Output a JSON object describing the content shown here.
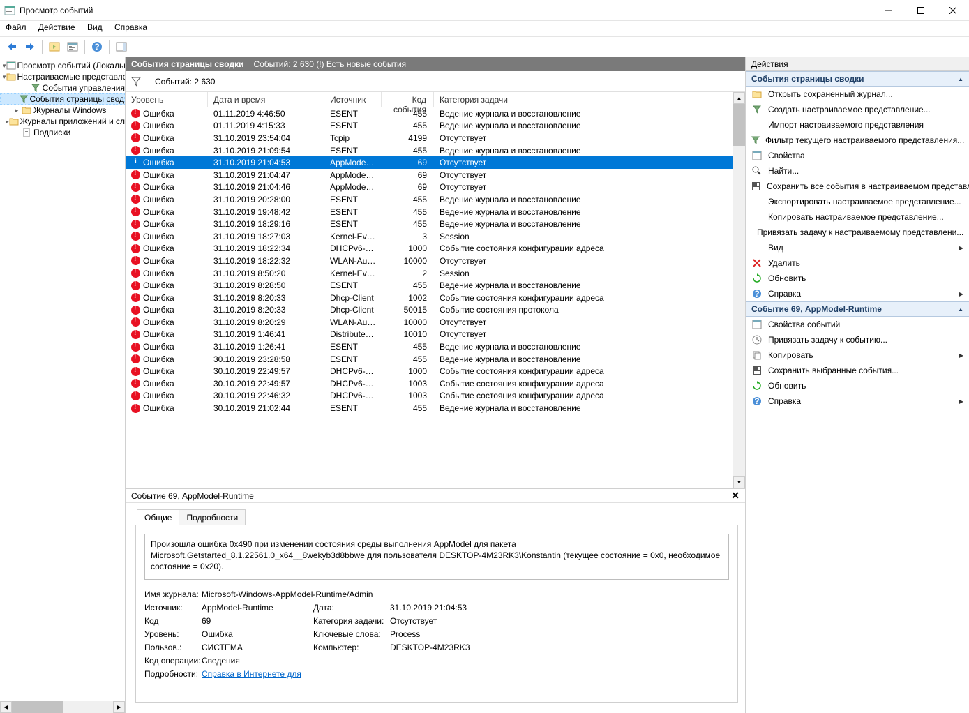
{
  "window": {
    "title": "Просмотр событий"
  },
  "menu": {
    "file": "Файл",
    "action": "Действие",
    "view": "Вид",
    "help": "Справка"
  },
  "tree": {
    "root": "Просмотр событий (Локальн",
    "custom_views": "Настраиваемые представле",
    "admin_events": "События управления",
    "summary_events": "События страницы свод",
    "windows_logs": "Журналы Windows",
    "app_service_logs": "Журналы приложений и сл",
    "subscriptions": "Подписки"
  },
  "center_header": {
    "title": "События страницы сводки",
    "count_text": "Событий: 2 630 (!) Есть новые события"
  },
  "filterbar": {
    "count": "Событий: 2 630"
  },
  "columns": {
    "level": "Уровень",
    "date": "Дата и время",
    "source": "Источник",
    "eventid": "Код события",
    "category": "Категория задачи"
  },
  "rows": [
    {
      "icon": "err",
      "level": "Ошибка",
      "date": "01.11.2019 4:46:50",
      "source": "ESENT",
      "id": "455",
      "cat": "Ведение журнала и восстановление"
    },
    {
      "icon": "err",
      "level": "Ошибка",
      "date": "01.11.2019 4:15:33",
      "source": "ESENT",
      "id": "455",
      "cat": "Ведение журнала и восстановление"
    },
    {
      "icon": "err",
      "level": "Ошибка",
      "date": "31.10.2019 23:54:04",
      "source": "Tcpip",
      "id": "4199",
      "cat": "Отсутствует"
    },
    {
      "icon": "err",
      "level": "Ошибка",
      "date": "31.10.2019 21:09:54",
      "source": "ESENT",
      "id": "455",
      "cat": "Ведение журнала и восстановление"
    },
    {
      "icon": "info",
      "level": "Ошибка",
      "date": "31.10.2019 21:04:53",
      "source": "AppModel-...",
      "id": "69",
      "cat": "Отсутствует",
      "sel": true
    },
    {
      "icon": "err",
      "level": "Ошибка",
      "date": "31.10.2019 21:04:47",
      "source": "AppModel-...",
      "id": "69",
      "cat": "Отсутствует"
    },
    {
      "icon": "err",
      "level": "Ошибка",
      "date": "31.10.2019 21:04:46",
      "source": "AppModel-...",
      "id": "69",
      "cat": "Отсутствует"
    },
    {
      "icon": "err",
      "level": "Ошибка",
      "date": "31.10.2019 20:28:00",
      "source": "ESENT",
      "id": "455",
      "cat": "Ведение журнала и восстановление"
    },
    {
      "icon": "err",
      "level": "Ошибка",
      "date": "31.10.2019 19:48:42",
      "source": "ESENT",
      "id": "455",
      "cat": "Ведение журнала и восстановление"
    },
    {
      "icon": "err",
      "level": "Ошибка",
      "date": "31.10.2019 18:29:16",
      "source": "ESENT",
      "id": "455",
      "cat": "Ведение журнала и восстановление"
    },
    {
      "icon": "err",
      "level": "Ошибка",
      "date": "31.10.2019 18:27:03",
      "source": "Kernel-Even...",
      "id": "3",
      "cat": "Session"
    },
    {
      "icon": "err",
      "level": "Ошибка",
      "date": "31.10.2019 18:22:34",
      "source": "DHCPv6-Cli...",
      "id": "1000",
      "cat": "Событие состояния конфигурации адреса"
    },
    {
      "icon": "err",
      "level": "Ошибка",
      "date": "31.10.2019 18:22:32",
      "source": "WLAN-Auto...",
      "id": "10000",
      "cat": "Отсутствует"
    },
    {
      "icon": "err",
      "level": "Ошибка",
      "date": "31.10.2019 8:50:20",
      "source": "Kernel-Even...",
      "id": "2",
      "cat": "Session"
    },
    {
      "icon": "err",
      "level": "Ошибка",
      "date": "31.10.2019 8:28:50",
      "source": "ESENT",
      "id": "455",
      "cat": "Ведение журнала и восстановление"
    },
    {
      "icon": "err",
      "level": "Ошибка",
      "date": "31.10.2019 8:20:33",
      "source": "Dhcp-Client",
      "id": "1002",
      "cat": "Событие состояния конфигурации адреса"
    },
    {
      "icon": "err",
      "level": "Ошибка",
      "date": "31.10.2019 8:20:33",
      "source": "Dhcp-Client",
      "id": "50015",
      "cat": "Событие состояния протокола"
    },
    {
      "icon": "err",
      "level": "Ошибка",
      "date": "31.10.2019 8:20:29",
      "source": "WLAN-Auto...",
      "id": "10000",
      "cat": "Отсутствует"
    },
    {
      "icon": "err",
      "level": "Ошибка",
      "date": "31.10.2019 1:46:41",
      "source": "Distributed...",
      "id": "10010",
      "cat": "Отсутствует"
    },
    {
      "icon": "err",
      "level": "Ошибка",
      "date": "31.10.2019 1:26:41",
      "source": "ESENT",
      "id": "455",
      "cat": "Ведение журнала и восстановление"
    },
    {
      "icon": "err",
      "level": "Ошибка",
      "date": "30.10.2019 23:28:58",
      "source": "ESENT",
      "id": "455",
      "cat": "Ведение журнала и восстановление"
    },
    {
      "icon": "err",
      "level": "Ошибка",
      "date": "30.10.2019 22:49:57",
      "source": "DHCPv6-Cli...",
      "id": "1000",
      "cat": "Событие состояния конфигурации адреса"
    },
    {
      "icon": "err",
      "level": "Ошибка",
      "date": "30.10.2019 22:49:57",
      "source": "DHCPv6-Cli...",
      "id": "1003",
      "cat": "Событие состояния конфигурации адреса"
    },
    {
      "icon": "err",
      "level": "Ошибка",
      "date": "30.10.2019 22:46:32",
      "source": "DHCPv6-Cli...",
      "id": "1003",
      "cat": "Событие состояния конфигурации адреса"
    },
    {
      "icon": "err",
      "level": "Ошибка",
      "date": "30.10.2019 21:02:44",
      "source": "ESENT",
      "id": "455",
      "cat": "Ведение журнала и восстановление"
    }
  ],
  "detail": {
    "header": "Событие 69, AppModel-Runtime",
    "tab_general": "Общие",
    "tab_details": "Подробности",
    "description": "Произошла ошибка 0x490 при изменении состояния среды выполнения AppModel для пакета Microsoft.Getstarted_8.1.22561.0_x64__8wekyb3d8bbwe для пользователя DESKTOP-4M23RK3\\Konstantin (текущее состояние = 0x0, необходимое состояние = 0x20).",
    "props": {
      "log_name_label": "Имя журнала:",
      "log_name": "Microsoft-Windows-AppModel-Runtime/Admin",
      "source_label": "Источник:",
      "source": "AppModel-Runtime",
      "date_label": "Дата:",
      "date": "31.10.2019 21:04:53",
      "code_label": "Код",
      "code": "69",
      "category_label": "Категория задачи:",
      "category": "Отсутствует",
      "level_label": "Уровень:",
      "level": "Ошибка",
      "keywords_label": "Ключевые слова:",
      "keywords": "Process",
      "user_label": "Пользов.:",
      "user": "СИСТЕМА",
      "computer_label": "Компьютер:",
      "computer": "DESKTOP-4M23RK3",
      "opcode_label": "Код операции:",
      "opcode": "Сведения",
      "details_label": "Подробности:",
      "details_link": "Справка в Интернете для "
    }
  },
  "actions": {
    "header": "Действия",
    "section1": "События страницы сводки",
    "open_saved_log": "Открыть сохраненный журнал...",
    "create_custom_view": "Создать настраиваемое представление...",
    "import_custom_view": "Импорт настраиваемого представления",
    "filter_current": "Фильтр текущего настраиваемого представления...",
    "properties": "Свойства",
    "find": "Найти...",
    "save_all": "Сохранить все события в настраиваемом представл...",
    "export_custom": "Экспортировать настраиваемое представление...",
    "copy_custom": "Копировать настраиваемое представление...",
    "attach_task": "Привязать задачу к настраиваемому представлени...",
    "view": "Вид",
    "delete": "Удалить",
    "refresh": "Обновить",
    "help": "Справка",
    "section2": "Событие 69, AppModel-Runtime",
    "event_props": "Свойства событий",
    "attach_task_event": "Привязать задачу к событию...",
    "copy": "Копировать",
    "save_selected": "Сохранить выбранные события...",
    "refresh2": "Обновить",
    "help2": "Справка"
  }
}
